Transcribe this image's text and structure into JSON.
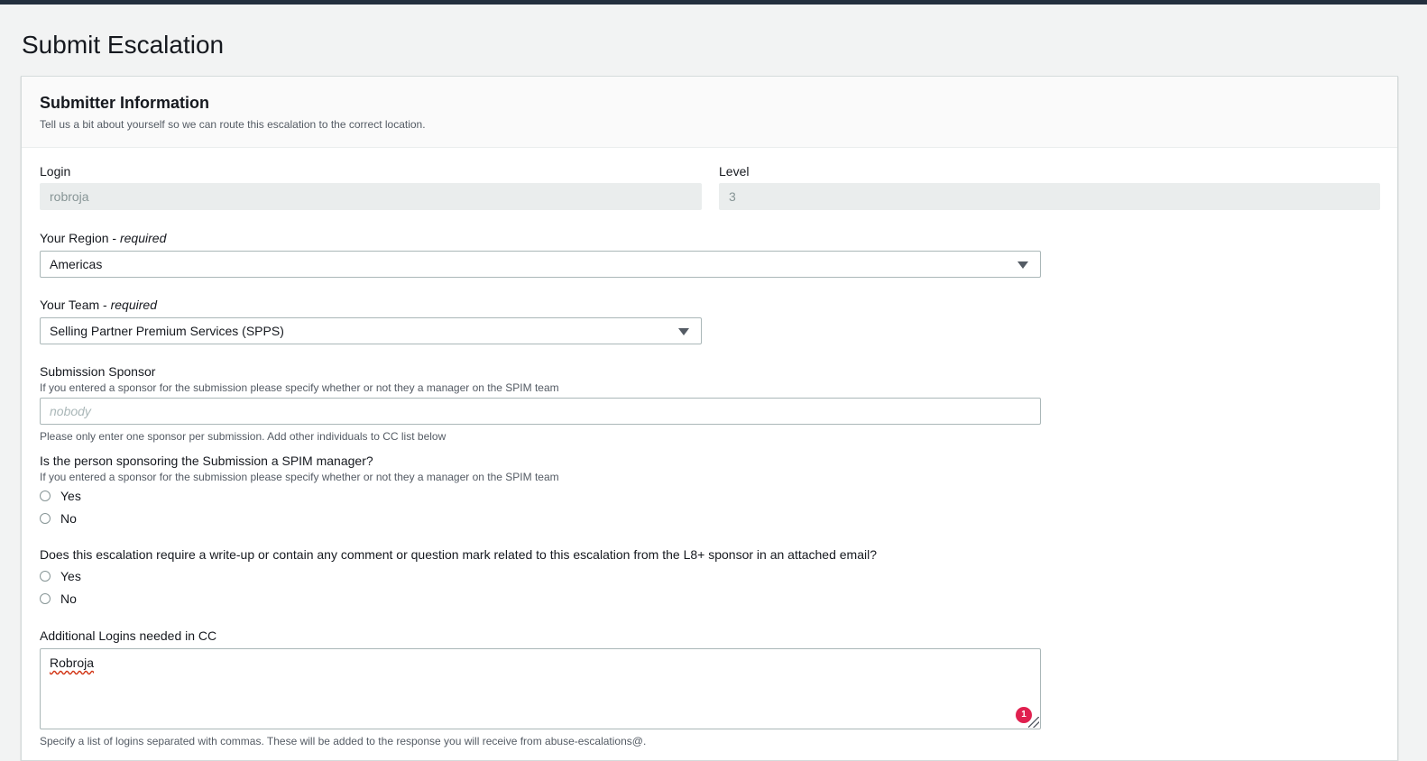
{
  "page": {
    "title": "Submit Escalation"
  },
  "panel": {
    "title": "Submitter Information",
    "description": "Tell us a bit about yourself so we can route this escalation to the correct location."
  },
  "login": {
    "label": "Login",
    "value": "robroja"
  },
  "level": {
    "label": "Level",
    "value": "3"
  },
  "region": {
    "label": "Your Region -",
    "required": "required",
    "value": "Americas"
  },
  "team": {
    "label": "Your Team -",
    "required": "required",
    "value": "Selling Partner Premium Services (SPPS)"
  },
  "sponsor": {
    "label": "Submission Sponsor",
    "description": "If you entered a sponsor for the submission please specify whether or not they a manager on the SPIM team",
    "placeholder": "nobody",
    "constraint": "Please only enter one sponsor per submission. Add other individuals to CC list below"
  },
  "spim_manager": {
    "label": "Is the person sponsoring the Submission a SPIM manager?",
    "description": "If you entered a sponsor for the submission please specify whether or not they a manager on the SPIM team",
    "options": [
      "Yes",
      "No"
    ]
  },
  "writeup": {
    "label": "Does this escalation require a write-up or contain any comment or question mark related to this escalation from the L8+ sponsor in an attached email?",
    "options": [
      "Yes",
      "No"
    ]
  },
  "cc": {
    "label": "Additional Logins needed in CC",
    "value": "Robroja",
    "badge_count": "1",
    "constraint": "Specify a list of logins separated with commas. These will be added to the response you will receive from abuse-escalations@."
  },
  "colors": {
    "topbar": "#232f3e",
    "background": "#f2f3f3",
    "badge": "#e0204f"
  }
}
